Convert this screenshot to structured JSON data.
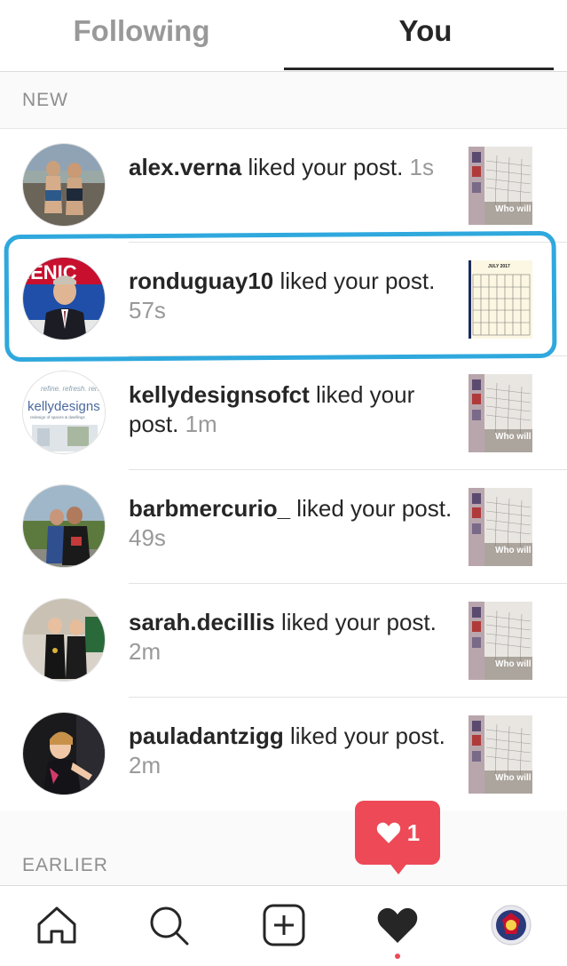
{
  "tabs": {
    "following": "Following",
    "you": "You"
  },
  "sections": {
    "new": "NEW",
    "earlier": "EARLIER"
  },
  "notifications": [
    {
      "user": "alex.verna",
      "action": " liked your post. ",
      "time": "1s"
    },
    {
      "user": "ronduguay10",
      "action": " liked your post. ",
      "time": "57s"
    },
    {
      "user": "kellydesignsofct",
      "action": " liked your post. ",
      "time": "1m"
    },
    {
      "user": "barbmercurio_",
      "action": " liked your post. ",
      "time": "49s"
    },
    {
      "user": "sarah.decillis",
      "action": " liked your post. ",
      "time": "2m"
    },
    {
      "user": "pauladantzigg",
      "action": " liked your post. ",
      "time": "2m"
    }
  ],
  "thumb_text": "Who will win?!",
  "kelly_avatar": {
    "top": "refine. refresh. renew.",
    "brand": "kellydesigns",
    "sub": "redesign of spaces & dwellings"
  },
  "calendar_title": "JULY 2017",
  "badge": {
    "count": "1",
    "icon": "heart-icon"
  },
  "nav": {
    "icons": [
      "home-icon",
      "search-icon",
      "add-icon",
      "heart-icon",
      "profile-icon"
    ]
  },
  "colors": {
    "accent": "#ed4956",
    "highlight": "#2fa8dd",
    "text": "#262626",
    "muted": "#999999"
  }
}
